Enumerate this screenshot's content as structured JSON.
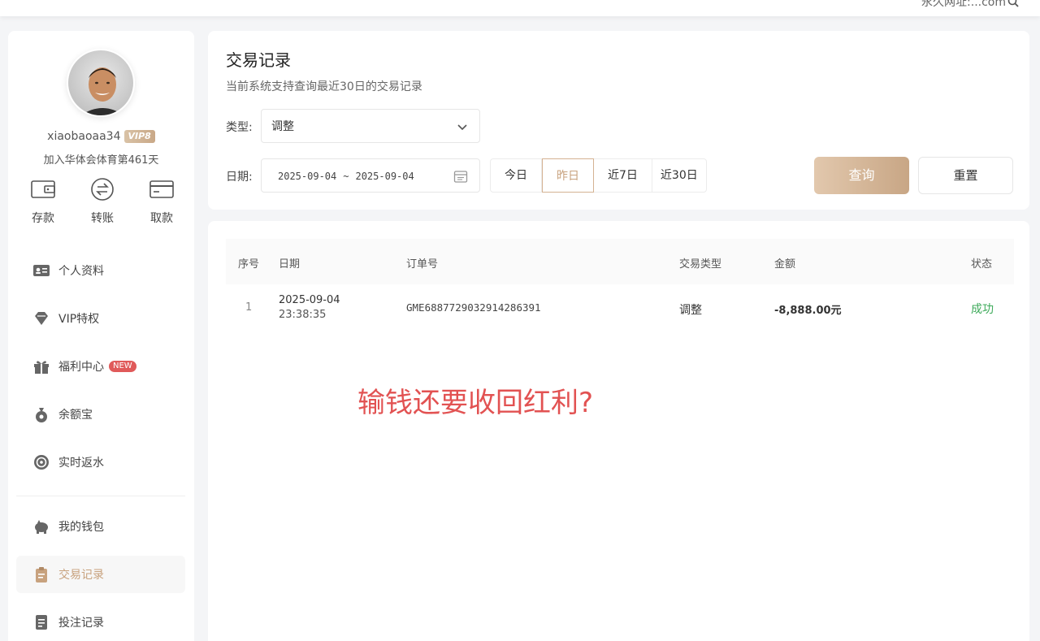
{
  "topbar": {
    "text": "永久网址:...com"
  },
  "user": {
    "username": "xiaobaoaa34",
    "vip_label": "VIP8",
    "join_text": "加入华体会体育第461天"
  },
  "quick_actions": [
    {
      "label": "存款",
      "icon": "wallet-card-icon"
    },
    {
      "label": "转账",
      "icon": "transfer-icon"
    },
    {
      "label": "取款",
      "icon": "card-icon"
    }
  ],
  "menu": {
    "items": [
      {
        "label": "个人资料",
        "icon": "id-card-icon"
      },
      {
        "label": "VIP特权",
        "icon": "diamond-icon"
      },
      {
        "label": "福利中心",
        "icon": "gift-icon",
        "badge": "NEW"
      },
      {
        "label": "余额宝",
        "icon": "money-bag-icon"
      },
      {
        "label": "实时返水",
        "icon": "rebate-icon"
      },
      {
        "label": "我的钱包",
        "icon": "piggy-bank-icon"
      },
      {
        "label": "交易记录",
        "icon": "clipboard-icon",
        "active": true
      },
      {
        "label": "投注记录",
        "icon": "document-icon"
      }
    ]
  },
  "page": {
    "title": "交易记录",
    "subtitle": "当前系统支持查询最近30日的交易记录"
  },
  "filters": {
    "type_label": "类型:",
    "type_value": "调整",
    "date_label": "日期:",
    "date_start": "2025-09-04",
    "date_sep": "~",
    "date_end": "2025-09-04",
    "quick_dates": [
      "今日",
      "昨日",
      "近7日",
      "近30日"
    ],
    "selected_quick_date": "昨日",
    "query_label": "查询",
    "reset_label": "重置"
  },
  "table": {
    "headers": [
      "序号",
      "日期",
      "订单号",
      "交易类型",
      "金额",
      "状态"
    ],
    "rows": [
      {
        "index": "1",
        "date": "2025-09-04",
        "time": "23:38:35",
        "order_no": "GME6887729032914286391",
        "type": "调整",
        "amount": "-8,888.00元",
        "status": "成功"
      }
    ]
  },
  "annotation": "输钱还要收回红利?",
  "colors": {
    "accent": "#c8a27e",
    "success": "#3daa5a",
    "annotation": "#e25252"
  }
}
